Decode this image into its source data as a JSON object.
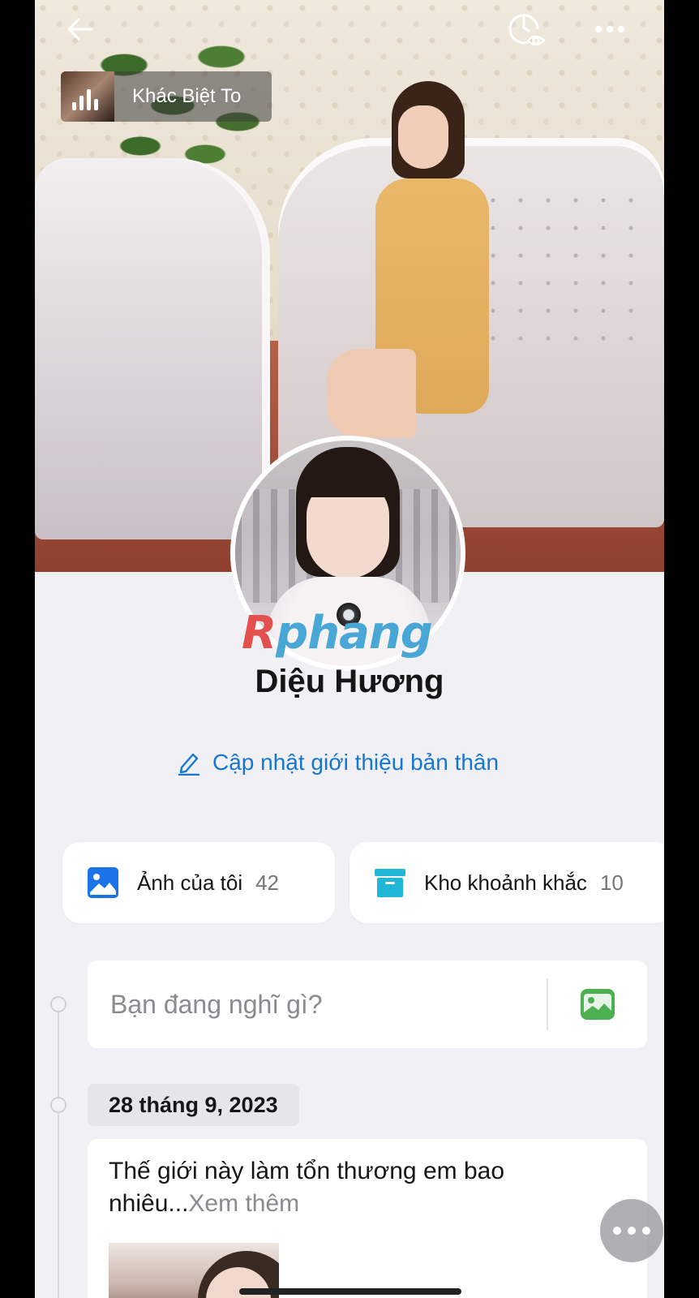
{
  "cover": {
    "music": {
      "title": "Khác Biệt To"
    }
  },
  "topbar": {
    "back_icon": "arrow-left-icon",
    "timeline_visibility_icon": "clock-eye-icon",
    "more_icon": "more-horizontal-icon"
  },
  "profile": {
    "name": "Diệu Hương",
    "update_intro_label": "Cập nhật giới thiệu bản thân",
    "watermark_first": "R",
    "watermark_rest": "phang"
  },
  "cards": [
    {
      "label": "Ảnh của tôi",
      "count": "42",
      "icon": "image-icon",
      "color": "#1a73e8"
    },
    {
      "label": "Kho khoảnh khắc",
      "count": "10",
      "icon": "archive-box-icon",
      "color": "#1fb6d7"
    }
  ],
  "composer": {
    "placeholder": "Bạn đang nghĩ gì?",
    "photo_icon": "gallery-icon",
    "photo_icon_color": "#4caf50"
  },
  "timeline": {
    "date": "28 tháng 9, 2023",
    "post": {
      "text": "Thế giới này làm tổn thương em bao nhiêu...",
      "more_label": "Xem thêm"
    }
  },
  "colors": {
    "accent": "#1677d2",
    "background": "#f1f0f4"
  }
}
